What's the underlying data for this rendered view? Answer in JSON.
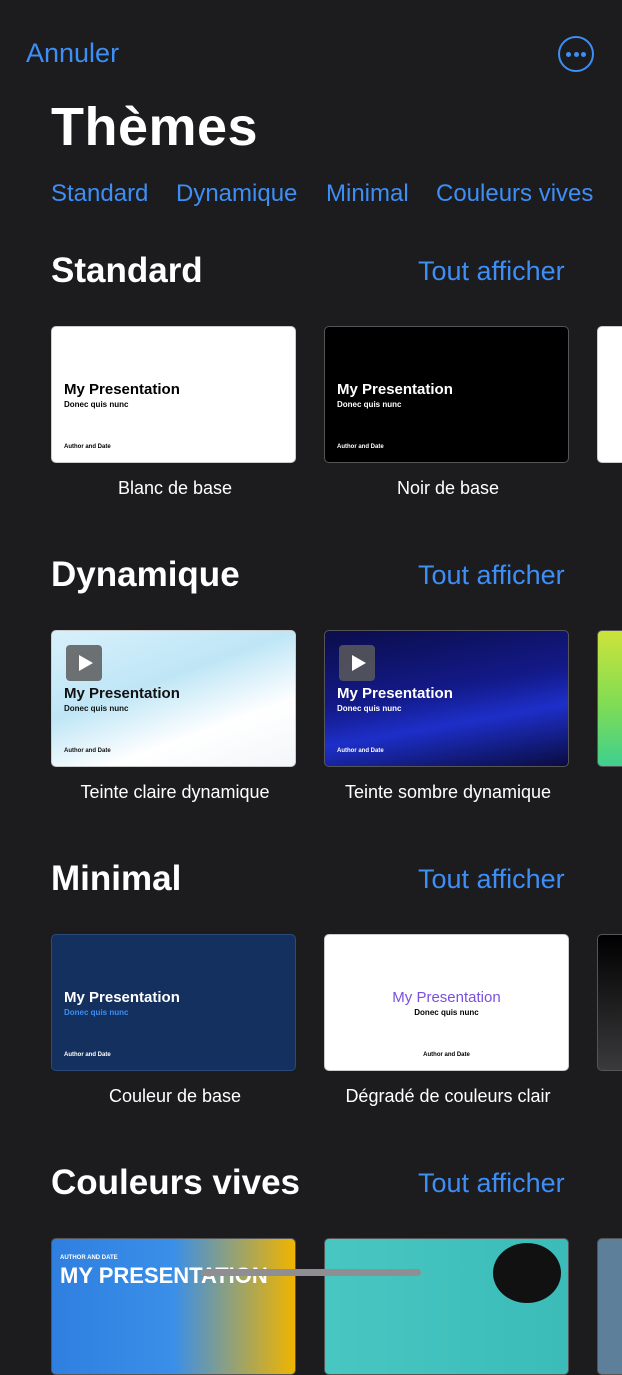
{
  "nav": {
    "cancel_label": "Annuler",
    "more_icon": "ellipsis-circle-icon"
  },
  "page_title": "Thèmes",
  "categories": [
    "Standard",
    "Dynamique",
    "Minimal",
    "Couleurs vives"
  ],
  "accent_color": "#3d8ef5",
  "see_all_label": "Tout afficher",
  "sample": {
    "title": "My Presentation",
    "subtitle": "Donec quis nunc",
    "author": "Author and Date"
  },
  "sections": [
    {
      "title": "Standard",
      "themes": [
        {
          "label": "Blanc de base"
        },
        {
          "label": "Noir de base"
        }
      ]
    },
    {
      "title": "Dynamique",
      "themes": [
        {
          "label": "Teinte claire dynamique"
        },
        {
          "label": "Teinte sombre dynamique"
        }
      ]
    },
    {
      "title": "Minimal",
      "themes": [
        {
          "label": "Couleur de base"
        },
        {
          "label": "Dégradé de couleurs clair"
        }
      ]
    },
    {
      "title": "Couleurs vives",
      "preview_text": {
        "author": "AUTHOR AND DATE",
        "title": "MY PRESENTATION"
      }
    }
  ]
}
